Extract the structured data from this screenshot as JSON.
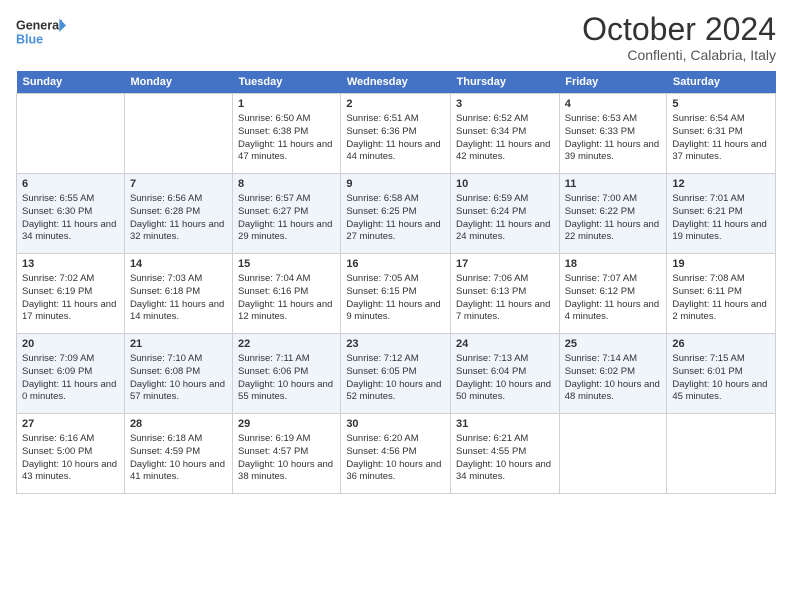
{
  "header": {
    "logo_line1": "General",
    "logo_line2": "Blue",
    "month_title": "October 2024",
    "subtitle": "Conflenti, Calabria, Italy"
  },
  "weekdays": [
    "Sunday",
    "Monday",
    "Tuesday",
    "Wednesday",
    "Thursday",
    "Friday",
    "Saturday"
  ],
  "weeks": [
    [
      {
        "day": "",
        "content": ""
      },
      {
        "day": "",
        "content": ""
      },
      {
        "day": "1",
        "content": "Sunrise: 6:50 AM\nSunset: 6:38 PM\nDaylight: 11 hours and 47 minutes."
      },
      {
        "day": "2",
        "content": "Sunrise: 6:51 AM\nSunset: 6:36 PM\nDaylight: 11 hours and 44 minutes."
      },
      {
        "day": "3",
        "content": "Sunrise: 6:52 AM\nSunset: 6:34 PM\nDaylight: 11 hours and 42 minutes."
      },
      {
        "day": "4",
        "content": "Sunrise: 6:53 AM\nSunset: 6:33 PM\nDaylight: 11 hours and 39 minutes."
      },
      {
        "day": "5",
        "content": "Sunrise: 6:54 AM\nSunset: 6:31 PM\nDaylight: 11 hours and 37 minutes."
      }
    ],
    [
      {
        "day": "6",
        "content": "Sunrise: 6:55 AM\nSunset: 6:30 PM\nDaylight: 11 hours and 34 minutes."
      },
      {
        "day": "7",
        "content": "Sunrise: 6:56 AM\nSunset: 6:28 PM\nDaylight: 11 hours and 32 minutes."
      },
      {
        "day": "8",
        "content": "Sunrise: 6:57 AM\nSunset: 6:27 PM\nDaylight: 11 hours and 29 minutes."
      },
      {
        "day": "9",
        "content": "Sunrise: 6:58 AM\nSunset: 6:25 PM\nDaylight: 11 hours and 27 minutes."
      },
      {
        "day": "10",
        "content": "Sunrise: 6:59 AM\nSunset: 6:24 PM\nDaylight: 11 hours and 24 minutes."
      },
      {
        "day": "11",
        "content": "Sunrise: 7:00 AM\nSunset: 6:22 PM\nDaylight: 11 hours and 22 minutes."
      },
      {
        "day": "12",
        "content": "Sunrise: 7:01 AM\nSunset: 6:21 PM\nDaylight: 11 hours and 19 minutes."
      }
    ],
    [
      {
        "day": "13",
        "content": "Sunrise: 7:02 AM\nSunset: 6:19 PM\nDaylight: 11 hours and 17 minutes."
      },
      {
        "day": "14",
        "content": "Sunrise: 7:03 AM\nSunset: 6:18 PM\nDaylight: 11 hours and 14 minutes."
      },
      {
        "day": "15",
        "content": "Sunrise: 7:04 AM\nSunset: 6:16 PM\nDaylight: 11 hours and 12 minutes."
      },
      {
        "day": "16",
        "content": "Sunrise: 7:05 AM\nSunset: 6:15 PM\nDaylight: 11 hours and 9 minutes."
      },
      {
        "day": "17",
        "content": "Sunrise: 7:06 AM\nSunset: 6:13 PM\nDaylight: 11 hours and 7 minutes."
      },
      {
        "day": "18",
        "content": "Sunrise: 7:07 AM\nSunset: 6:12 PM\nDaylight: 11 hours and 4 minutes."
      },
      {
        "day": "19",
        "content": "Sunrise: 7:08 AM\nSunset: 6:11 PM\nDaylight: 11 hours and 2 minutes."
      }
    ],
    [
      {
        "day": "20",
        "content": "Sunrise: 7:09 AM\nSunset: 6:09 PM\nDaylight: 11 hours and 0 minutes."
      },
      {
        "day": "21",
        "content": "Sunrise: 7:10 AM\nSunset: 6:08 PM\nDaylight: 10 hours and 57 minutes."
      },
      {
        "day": "22",
        "content": "Sunrise: 7:11 AM\nSunset: 6:06 PM\nDaylight: 10 hours and 55 minutes."
      },
      {
        "day": "23",
        "content": "Sunrise: 7:12 AM\nSunset: 6:05 PM\nDaylight: 10 hours and 52 minutes."
      },
      {
        "day": "24",
        "content": "Sunrise: 7:13 AM\nSunset: 6:04 PM\nDaylight: 10 hours and 50 minutes."
      },
      {
        "day": "25",
        "content": "Sunrise: 7:14 AM\nSunset: 6:02 PM\nDaylight: 10 hours and 48 minutes."
      },
      {
        "day": "26",
        "content": "Sunrise: 7:15 AM\nSunset: 6:01 PM\nDaylight: 10 hours and 45 minutes."
      }
    ],
    [
      {
        "day": "27",
        "content": "Sunrise: 6:16 AM\nSunset: 5:00 PM\nDaylight: 10 hours and 43 minutes."
      },
      {
        "day": "28",
        "content": "Sunrise: 6:18 AM\nSunset: 4:59 PM\nDaylight: 10 hours and 41 minutes."
      },
      {
        "day": "29",
        "content": "Sunrise: 6:19 AM\nSunset: 4:57 PM\nDaylight: 10 hours and 38 minutes."
      },
      {
        "day": "30",
        "content": "Sunrise: 6:20 AM\nSunset: 4:56 PM\nDaylight: 10 hours and 36 minutes."
      },
      {
        "day": "31",
        "content": "Sunrise: 6:21 AM\nSunset: 4:55 PM\nDaylight: 10 hours and 34 minutes."
      },
      {
        "day": "",
        "content": ""
      },
      {
        "day": "",
        "content": ""
      }
    ]
  ]
}
